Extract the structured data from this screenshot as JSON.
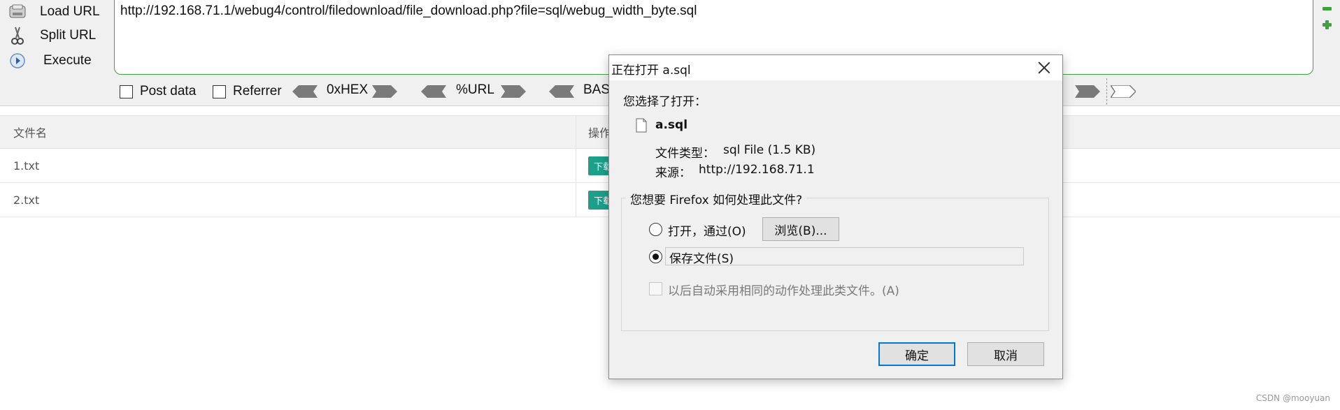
{
  "hackbar": {
    "actions": [
      {
        "label": "Load URL",
        "icon": "load-url-icon"
      },
      {
        "label": "Split URL",
        "icon": "scissors-icon"
      },
      {
        "label": "Execute",
        "icon": "play-icon"
      }
    ],
    "url": "http://192.168.71.1/webug4/control/filedownload/file_download.php?file=sql/webug_width_byte.sql",
    "options": {
      "post_data": "Post data",
      "referrer": "Referrer"
    },
    "encoders": [
      "0xHEX",
      "%URL",
      "BAS"
    ],
    "accent_color": "#3fa33f"
  },
  "table": {
    "headers": [
      "文件名",
      "操作"
    ],
    "rows": [
      {
        "name": "1.txt",
        "action": "下载"
      },
      {
        "name": "2.txt",
        "action": "下载"
      }
    ],
    "button_color": "#1e9f8a"
  },
  "dialog": {
    "title": "正在打开 a.sql",
    "intro": "您选择了打开：",
    "file_name": "a.sql",
    "file_type_label": "文件类型：",
    "file_type_value": "sql File (1.5 KB)",
    "source_label": "来源：",
    "source_value": "http://192.168.71.1",
    "group_title": "您想要 Firefox 如何处理此文件?",
    "open_with_label": "打开，通过(O)",
    "browse_label": "浏览(B)...",
    "save_label": "保存文件(S)",
    "selected_option": "save",
    "auto_label": "以后自动采用相同的动作处理此类文件。(A)",
    "ok_label": "确定",
    "cancel_label": "取消"
  },
  "watermark": "CSDN @mooyuan"
}
